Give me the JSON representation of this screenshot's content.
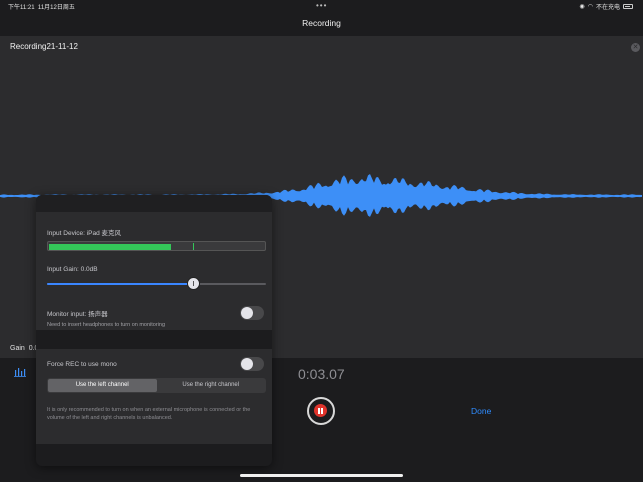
{
  "status_bar": {
    "time": "下午11:21",
    "date": "11月12日周五",
    "charging": "不在充电"
  },
  "nav": {
    "title": "Recording"
  },
  "recording": {
    "name": "Recording21-11-12",
    "gain_label": "Gain",
    "gain_value": "0.0",
    "elapsed": "0:03.07"
  },
  "actions": {
    "done": "Done"
  },
  "popover": {
    "input_device_label": "Input Device: iPad 麦克风",
    "input_gain_label": "Input Gain: 0.0dB",
    "input_gain_level": 0.67,
    "meter_level_left": 0.56,
    "meter_level_right": 0.56,
    "meter_peak": 0.67,
    "monitor_label": "Monitor input: 扬声器",
    "monitor_hint": "Need to insert headphones to turn on monitoring",
    "monitor_enabled": false,
    "force_mono_label": "Force REC to use mono",
    "force_mono_enabled": false,
    "channel_options": [
      "Use the left channel",
      "Use the right channel"
    ],
    "channel_selected": "Use the left channel",
    "mono_note": "It is only recommended to turn on when an external microphone is connected or the volume of the left and right channels is unbalanced."
  },
  "colors": {
    "accent": "#2f8cff",
    "waveform": "#3d8ff7",
    "record": "#e0342c",
    "meter": "#34c759"
  }
}
